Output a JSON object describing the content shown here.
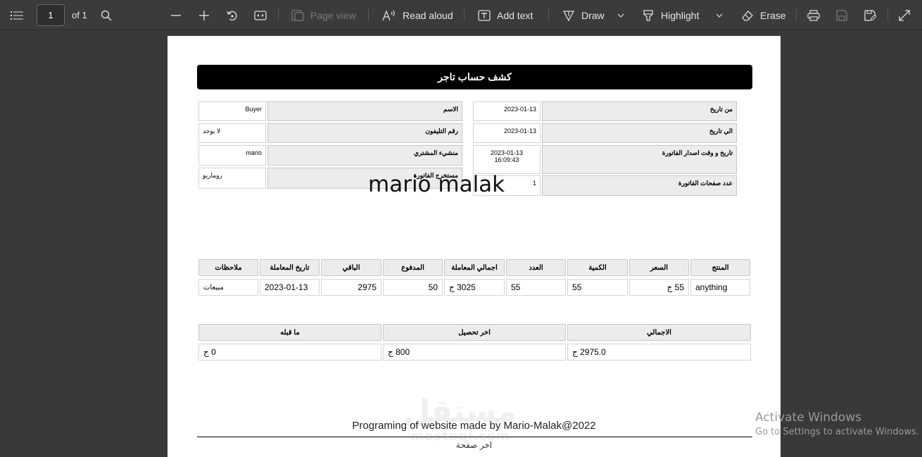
{
  "toolbar": {
    "page_current": "1",
    "page_total": "of 1",
    "page_view": "Page view",
    "read_aloud": "Read aloud",
    "add_text": "Add text",
    "draw": "Draw",
    "highlight": "Highlight",
    "erase": "Erase"
  },
  "document": {
    "title": "كشف حساب تاجر",
    "left_fields": [
      {
        "label": "الاسم",
        "value": "Buyer"
      },
      {
        "label": "رقم التليفون",
        "value": "لا يوجد"
      },
      {
        "label": "منشيء المشتري",
        "value": "mario"
      },
      {
        "label": "مستخرج الفاتورة",
        "value": "روماريو"
      }
    ],
    "right_fields": [
      {
        "label": "من تاريخ",
        "value": "2023-01-13"
      },
      {
        "label": "الي تاريخ",
        "value": "2023-01-13"
      },
      {
        "label": "تاريخ و وقت اصدار الفاتورة",
        "value": "2023-01-13",
        "value2": "16:09:43"
      },
      {
        "label": "عدد صفحات الفاتورة",
        "value": "1"
      }
    ],
    "overlay_name": "mario malak",
    "items_table": {
      "headers": [
        "المنتج",
        "السعر",
        "الكمية",
        "العدد",
        "اجمالي المعاملة",
        "المدفوع",
        "الباقي",
        "تاريخ المعاملة",
        "ملاحظات"
      ],
      "row": [
        "anything",
        "55 ج",
        "55",
        "55",
        "3025 ج",
        "50",
        "2975",
        "2023-01-13",
        "مبيعات"
      ]
    },
    "summary_table": {
      "headers": [
        "الاجمالي",
        "اخر تحصيل",
        "ما قبله"
      ],
      "row": [
        "2975.0 ج",
        "800 ج",
        "0 ج"
      ]
    },
    "footer": "Programing of website made by Mario-Malak@2022",
    "last_page": "اخر صفحة",
    "watermark_ar": "مستقل",
    "watermark_en": "mostaql.com"
  },
  "os_notice": {
    "title": "Activate Windows",
    "subtitle": "Go to Settings to activate Windows."
  }
}
